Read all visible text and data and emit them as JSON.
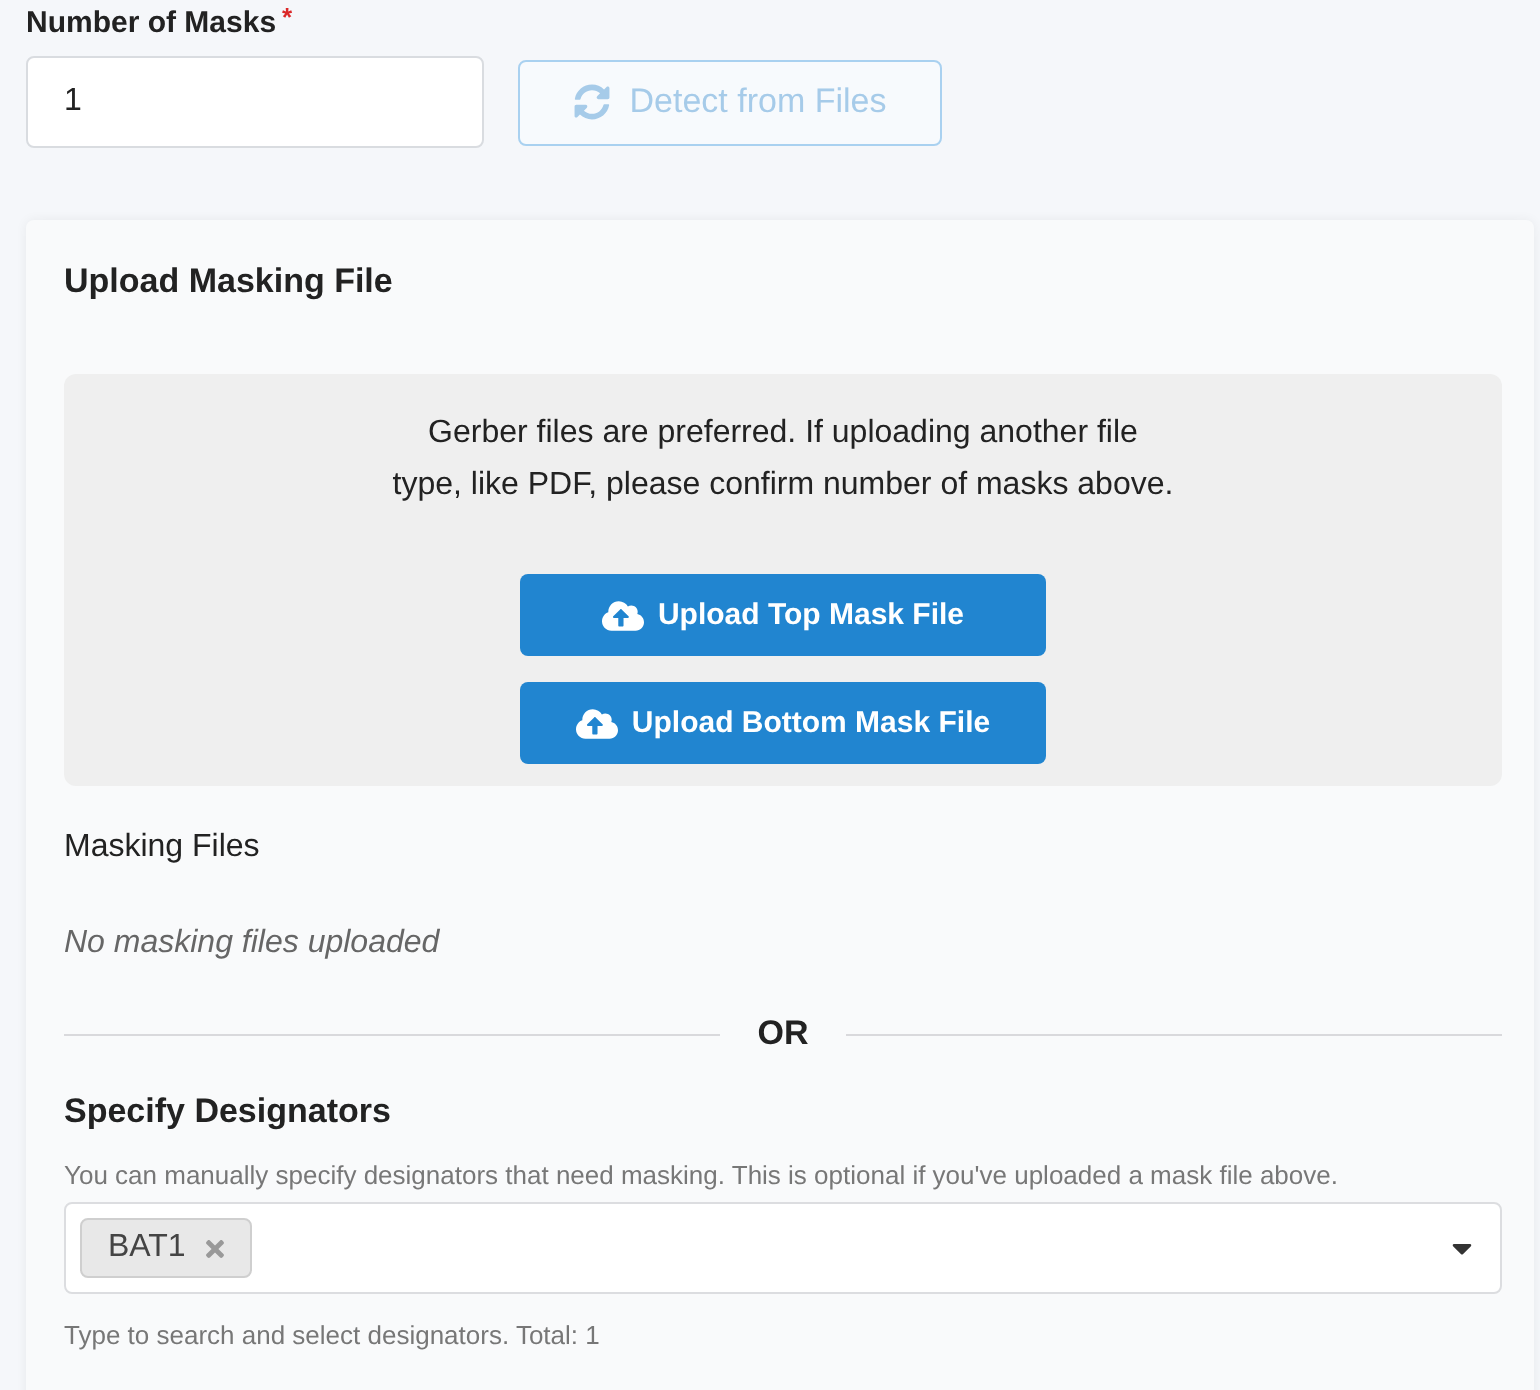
{
  "number_of_masks": {
    "label": "Number of Masks",
    "required_mark": "*",
    "value": "1"
  },
  "detect_button": {
    "label": "Detect from Files",
    "disabled": true
  },
  "upload_panel": {
    "title": "Upload Masking File",
    "instructions": "Gerber files are preferred. If uploading another file\ntype, like PDF, please confirm number of masks above.",
    "buttons": [
      {
        "label": "Upload Top Mask File"
      },
      {
        "label": "Upload Bottom Mask File"
      }
    ]
  },
  "masking_files": {
    "title": "Masking Files",
    "empty_message": "No masking files uploaded"
  },
  "divider": {
    "label": "OR"
  },
  "designators": {
    "title": "Specify Designators",
    "description": "You can manually specify designators that need masking. This is optional if you've uploaded a mask file above.",
    "selected": [
      {
        "label": "BAT1"
      }
    ],
    "hint": "Type to search and select designators. Total: 1"
  }
}
